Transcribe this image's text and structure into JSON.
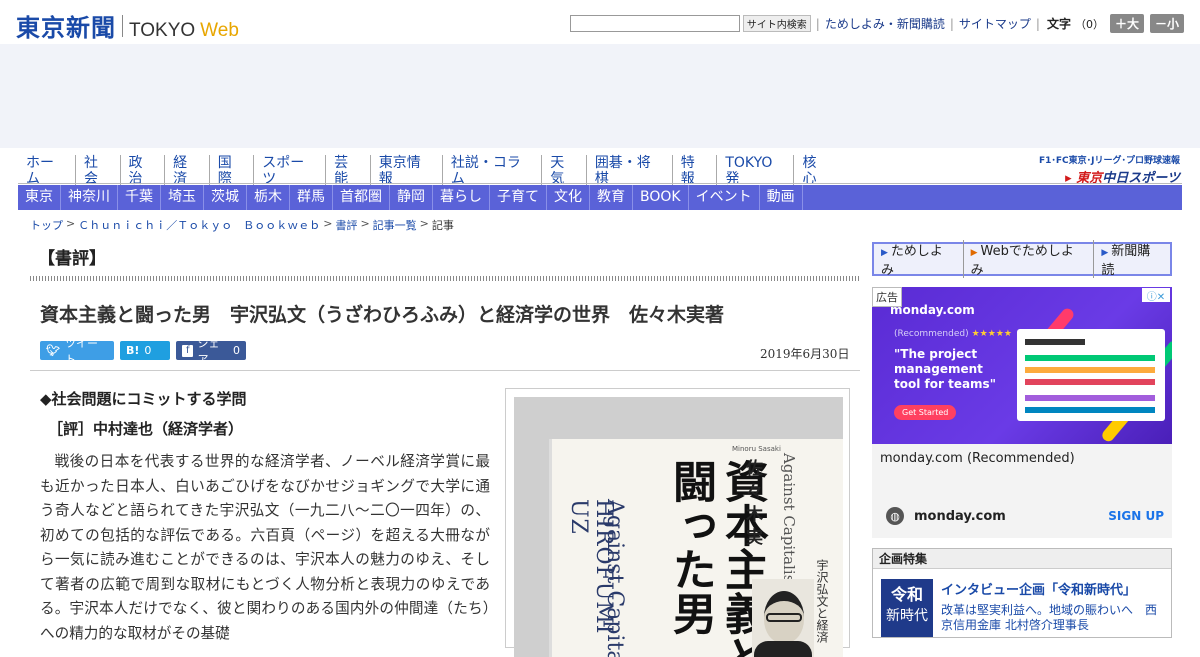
{
  "header": {
    "logo_jp": "東京新聞",
    "logo_tokyo": "TOKYO",
    "logo_web": "Web",
    "search_placeholder": "",
    "search_button": "サイト内検索",
    "links": [
      "ためしよみ・新聞購読",
      "サイトマップ"
    ],
    "font_label": "文字",
    "font_count": "（0）",
    "font_bigger": "＋大",
    "font_smaller": "－小"
  },
  "nav_primary": [
    "ホーム",
    "社会",
    "政治",
    "経済",
    "国際",
    "スポーツ",
    "芸能",
    "東京情報",
    "社説・コラム",
    "天気",
    "囲碁・将棋",
    "特報",
    "TOKYO発",
    "核心"
  ],
  "chunichi": {
    "top_text": "F1･FC東京･Jリーグ･プロ野球速報",
    "brand_prefix": "東京",
    "brand_main": "中日スポーツ"
  },
  "nav_secondary": [
    "東京",
    "神奈川",
    "千葉",
    "埼玉",
    "茨城",
    "栃木",
    "群馬",
    "首都圏",
    "静岡",
    "暮らし",
    "子育て",
    "文化",
    "教育",
    "BOOK",
    "イベント",
    "動画"
  ],
  "breadcrumb": [
    "トップ",
    "Ｃｈｕｎｉｃｈｉ／Ｔｏｋｙｏ　Ｂｏｏｋｗｅｂ",
    "書評",
    "記事一覧",
    "記事"
  ],
  "article": {
    "section": "【書評】",
    "title": "資本主義と闘った男　宇沢弘文（うざわひろふみ）と経済学の世界　佐々木実著",
    "tweet_label": "ツイート",
    "hatena_label": "B!",
    "hatena_count": "0",
    "facebook_label": "シェア",
    "facebook_count": "0",
    "date": "2019年6月30日",
    "subhead": "◆社会問題にコミットする学問",
    "reviewer": "［評］中村達也（経済学者）",
    "body": "戦後の日本を代表する世界的な経済学者、ノーベル経済学賞に最も近かった日本人、白いあごひげをなびかせジョギングで大学に通う奇人などと語られてきた宇沢弘文（一九二八～二〇一四年）の、初めての包括的な評伝である。六百頁（ページ）を超える大冊ながら一気に読み進むことができるのは、宇沢本人の魅力のゆえ、そして著者の広範で周到な取材にもとづく人物分析と表現力のゆえである。宇沢本人だけでなく、彼と関わりのある国内外の仲間達（たち）への精力的な取材がその基礎"
  },
  "book": {
    "title": "資本主義と闘った男",
    "author": "佐々木実",
    "author_en": "Minoru Sasaki",
    "en_title_1": "HIROFUMI UZ",
    "en_title_2": "Against Capita",
    "en_title_3": "Against Capitalism",
    "subtitle": "宇沢弘文と経済"
  },
  "sidebar": {
    "links": [
      "ためしよみ",
      "Webでためしよみ",
      "新聞購読"
    ],
    "ad": {
      "tag": "広告",
      "brand": "monday.com",
      "recommended": "(Recommended)",
      "headline": "\"The project management tool for teams\"",
      "cta": "Get Started",
      "title": "monday.com (Recommended)",
      "domain": "monday.com",
      "signup": "SIGN UP"
    },
    "feature": {
      "header": "企画特集",
      "thumb_line1": "令和",
      "thumb_line2": "新時代",
      "title": "インタビュー企画「令和新時代」",
      "desc": "改革は堅実利益へ。地域の賑わいへ　西京信用金庫 北村啓介理事長"
    }
  },
  "colors": {
    "brand_blue": "#1a4aa8",
    "nav_bar": "#5a62d8",
    "web_orange": "#e8a600",
    "twitter": "#3e9ee6",
    "facebook": "#3b5998"
  }
}
